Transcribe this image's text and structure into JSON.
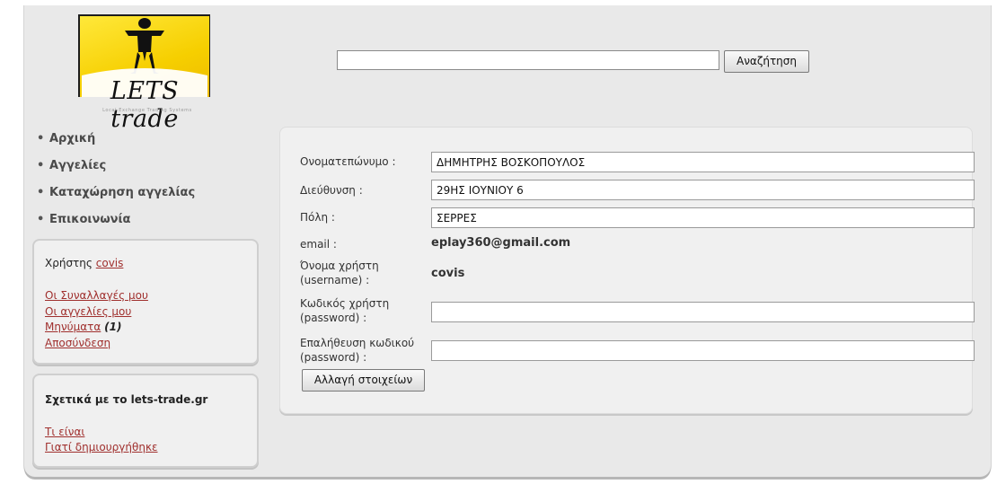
{
  "logo": {
    "text": "LETS trade",
    "subtitle": "Local Exchange Trading Systems"
  },
  "search": {
    "value": "",
    "button_label": "Αναζήτηση"
  },
  "nav": {
    "bullet": "•",
    "items": [
      {
        "label": "Αρχική"
      },
      {
        "label": "Αγγελίες"
      },
      {
        "label": "Καταχώρηση αγγελίας"
      },
      {
        "label": "Επικοινωνία"
      }
    ]
  },
  "user_box": {
    "prefix": "Χρήστης",
    "username": "covis",
    "links": {
      "transactions": "Οι Συναλλαγές μου",
      "ads": "Οι αγγελίες μου",
      "messages": "Μηνύματα",
      "logout": "Αποσύνδεση"
    },
    "message_count": "(1)"
  },
  "about_box": {
    "title": "Σχετικά με το lets-trade.gr",
    "links": {
      "what": "Τι είναι",
      "why": "Γιατί δημιουργήθηκε"
    }
  },
  "form": {
    "fullname": {
      "label": "Ονοματεπώνυμο :",
      "value": "ΔΗΜΗΤΡΗΣ ΒΟΣΚΟΠΟΥΛΟΣ"
    },
    "address": {
      "label": "Διεύθυνση :",
      "value": "29ΗΣ ΙΟΥΝΙΟΥ 6"
    },
    "city": {
      "label": "Πόλη :",
      "value": "ΣΕΡΡΕΣ"
    },
    "email": {
      "label": "email :",
      "value": "eplay360@gmail.com"
    },
    "username": {
      "label_1": "Όνομα χρήστη",
      "label_2": "(username) :",
      "value": "covis"
    },
    "password": {
      "label_1": "Κωδικός χρήστη",
      "label_2": "(password) :",
      "value": ""
    },
    "password_confirm": {
      "label_1": "Επαλήθευση κωδικού",
      "label_2": "(password) :",
      "value": ""
    },
    "submit_label": "Αλλαγή στοιχείων"
  }
}
